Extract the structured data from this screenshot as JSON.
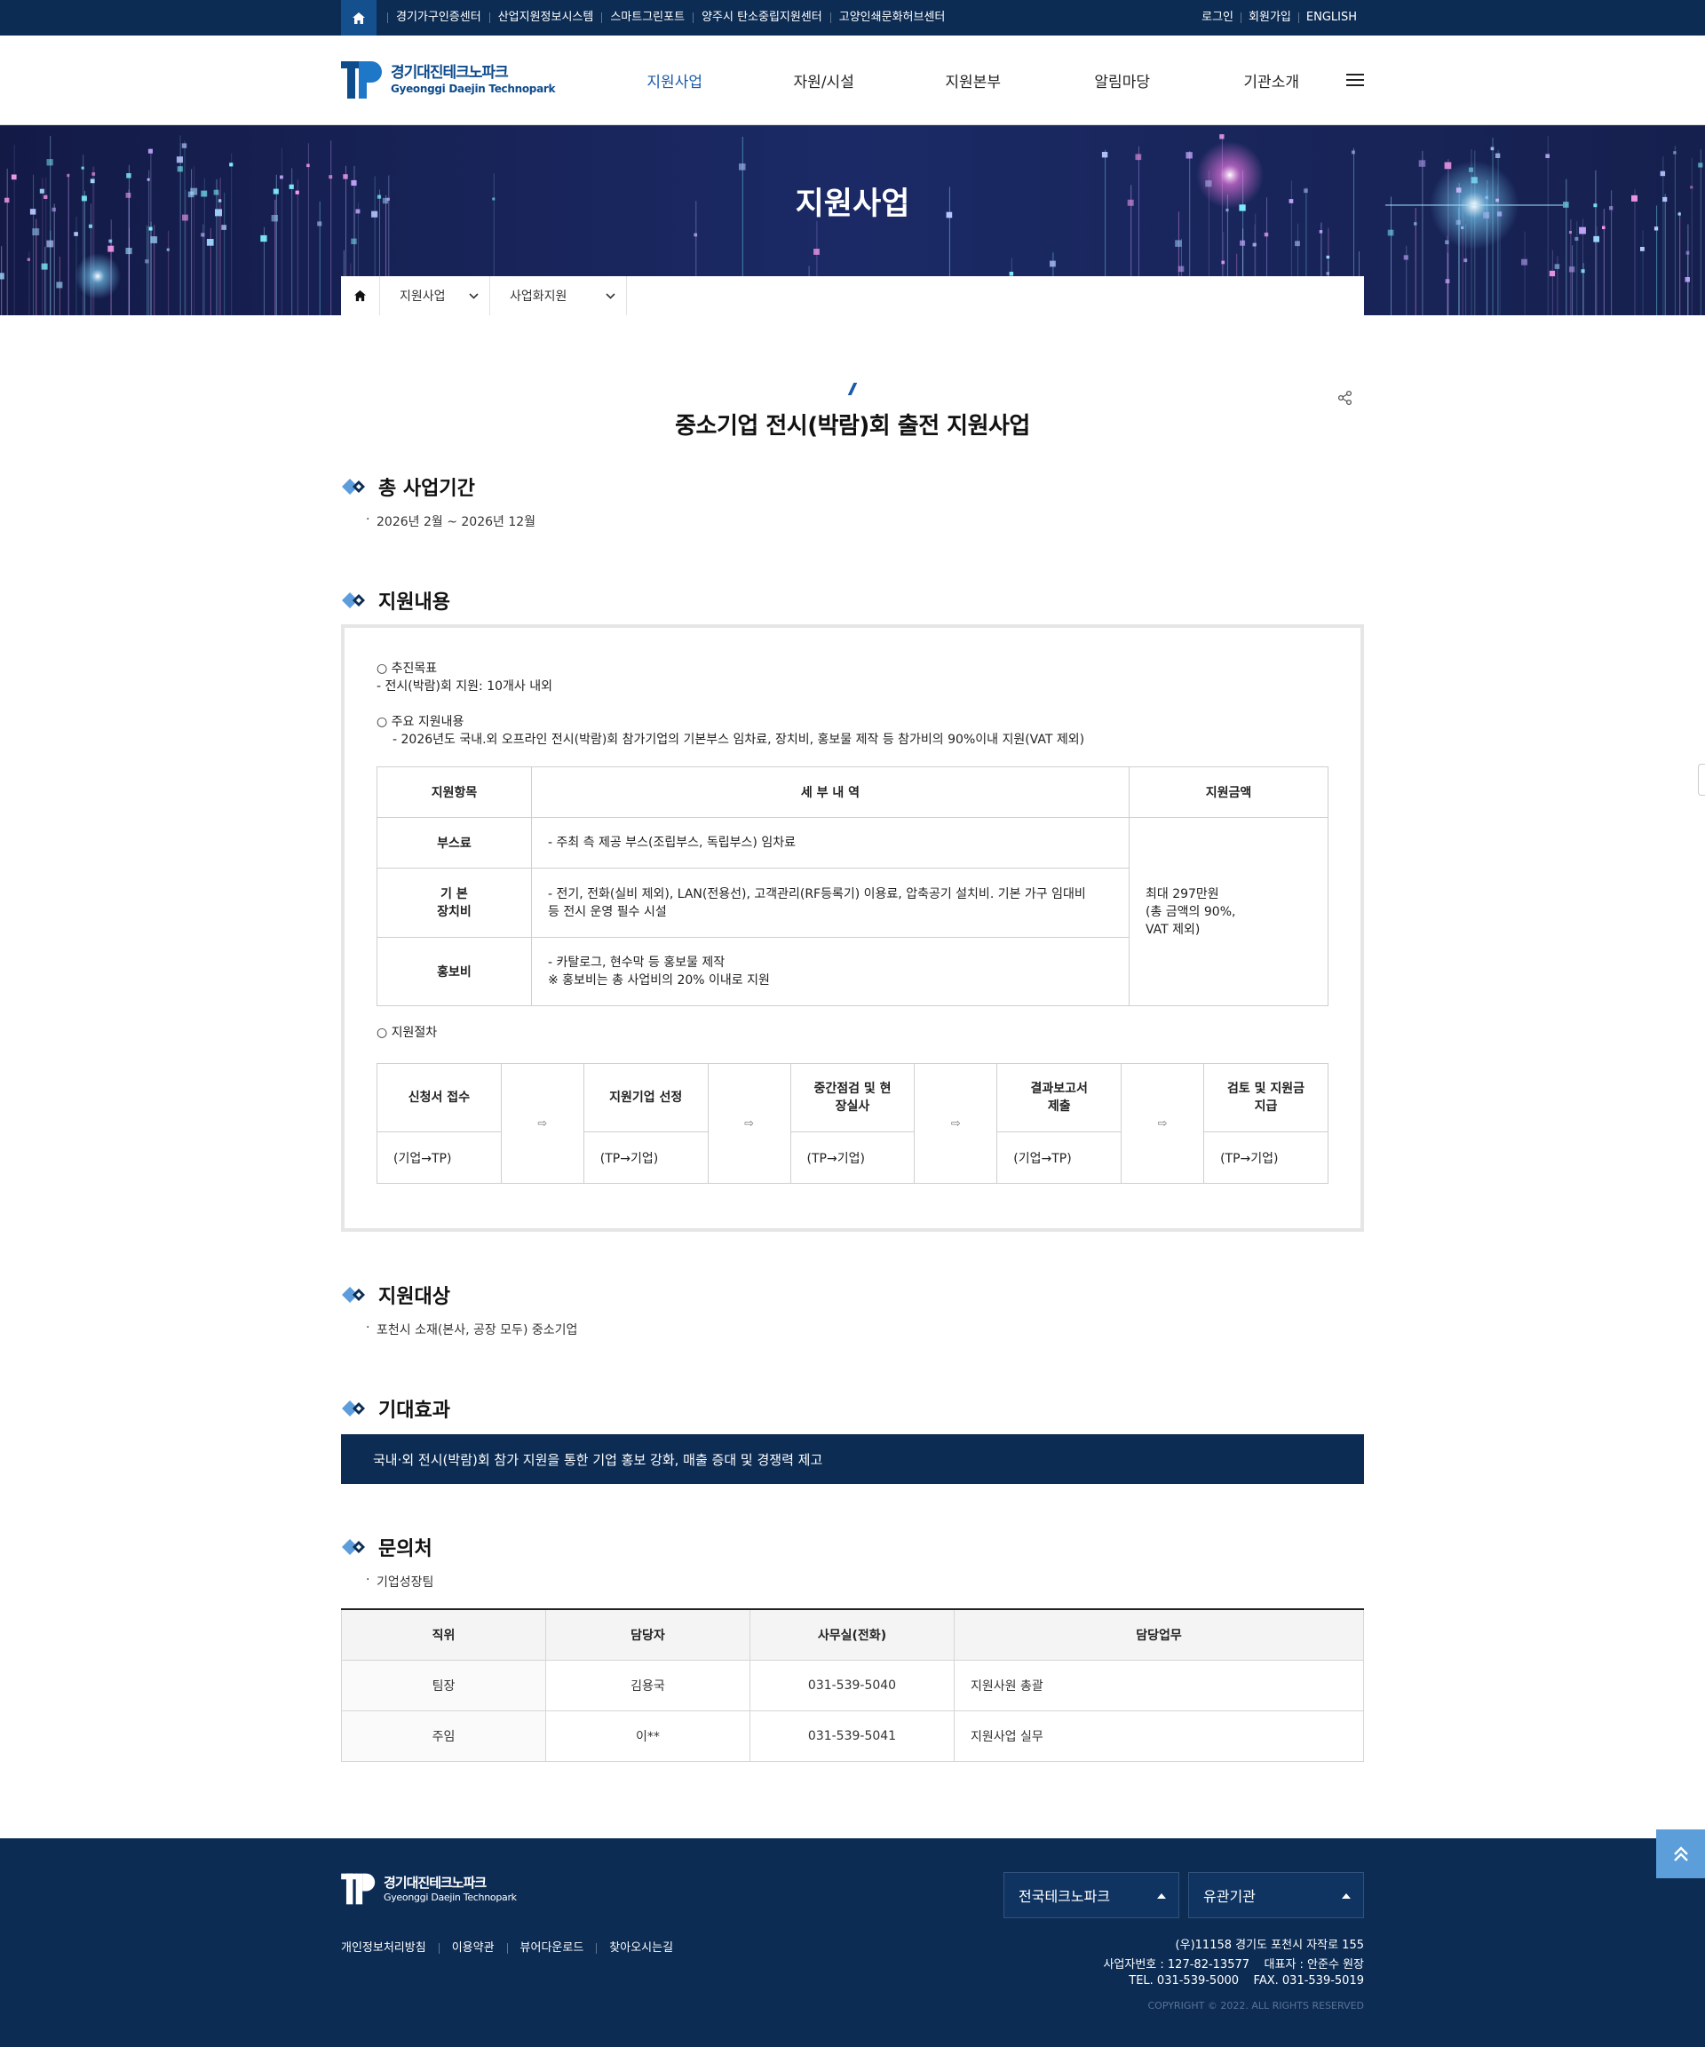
{
  "topbar": {
    "sites": [
      "경기가구인증센터",
      "산업지원정보시스템",
      "스마트그린포트",
      "양주시 탄소중립지원센터",
      "고양인쇄문화허브센터"
    ],
    "util": [
      "로그인",
      "회원가입",
      "ENGLISH"
    ]
  },
  "logo": {
    "kr": "경기대진테크노파크",
    "en": "Gyeonggi Daejin Technopark"
  },
  "gnb": [
    "지원사업",
    "자원/시설",
    "지원본부",
    "알림마당",
    "기관소개"
  ],
  "visual": {
    "title": "지원사업"
  },
  "location": {
    "depth1": "지원사업",
    "depth2": "사업화지원"
  },
  "page": {
    "title": "중소기업 전시(박람)회 출전 지원사업"
  },
  "period": {
    "heading": "총 사업기간",
    "text": "2026년 2월 ~ 2026년 12월"
  },
  "support": {
    "heading": "지원내용",
    "goal_title": "○ 추진목표",
    "goal_text": "- 전시(박람)회 지원: 10개사 내외",
    "main_title": "○ 주요 지원내용",
    "main_text": "- 2026년도 국내.외 오프라인 전시(박람)회 참가기업의 기본부스 임차료, 장치비, 홍보물 제작 등 참가비의 90%이내 지원(VAT 제외)",
    "table": {
      "headers": [
        "지원항목",
        "세 부 내 역",
        "지원금액"
      ],
      "rows": [
        {
          "item": "부스료",
          "detail": "- 주최 측 제공 부스(조립부스, 독립부스) 임차료",
          "detail2": ""
        },
        {
          "item": "기 본",
          "item2": "장치비",
          "detail": "- 전기, 전화(실비 제외), LAN(전용선), 고객관리(RF등록기) 이용료, 압축공기 설치비. 기본 가구 임대비",
          "detail2": "등 전시 운영 필수 시설"
        },
        {
          "item": "홍보비",
          "detail": "- 카탈로그, 현수막 등 홍보물 제작",
          "detail2": "※ 홍보비는 총 사업비의 20% 이내로 지원"
        }
      ],
      "amount": [
        "최대 297만원",
        "(총 금액의 90%,",
        "VAT 제외)"
      ]
    },
    "proc_title": "○ 지원절차",
    "steps": [
      {
        "name": "신청서 접수",
        "name2": "",
        "flow": "(기업→TP)"
      },
      {
        "name": "지원기업 선정",
        "name2": "",
        "flow": "(TP→기업)"
      },
      {
        "name": "중간점검 및 현",
        "name2": "장실사",
        "flow": "(TP→기업)"
      },
      {
        "name": "결과보고서",
        "name2": "제출",
        "flow": "(기업→TP)"
      },
      {
        "name": "검토 및 지원금",
        "name2": "지급",
        "flow": "(TP→기업)"
      }
    ],
    "arrow": "⇨"
  },
  "target": {
    "heading": "지원대상",
    "text": "포천시 소재(본사, 공장 모두) 중소기업"
  },
  "effect": {
    "heading": "기대효과",
    "text": "국내·외 전시(박람)회 참가 지원을 통한 기업 홍보 강화, 매출 증대 및 경쟁력 제고"
  },
  "contact": {
    "heading": "문의처",
    "team": "기업성장팀",
    "headers": [
      "직위",
      "담당자",
      "사무실(전화)",
      "담당업무"
    ],
    "rows": [
      [
        "팀장",
        "김용국",
        "031-539-5040",
        "지원사원 총괄"
      ],
      [
        "주임",
        "이**",
        "031-539-5041",
        "지원사업 실무"
      ]
    ]
  },
  "footer": {
    "logo_kr": "경기대진테크노파크",
    "logo_en": "Gyeonggi Daejin Technopark",
    "links": [
      "개인정보처리방침",
      "이용약관",
      "뷰어다운로드",
      "찾아오시는길"
    ],
    "select1": "전국테크노파크",
    "select2": "유관기관",
    "address": "(우)11158 경기도 포천시 자작로 155",
    "bizno": "사업자번호 : 127-82-13577    대표자 : 안준수 원장",
    "tel": "TEL. 031-539-5000    FAX. 031-539-5019",
    "copy": "COPYRIGHT © 2022. ALL RIGHTS RESERVED"
  },
  "colors": {
    "navy": "#0c2c54",
    "accent": "#1a5aa8",
    "topbtn": "#5b9ed9"
  }
}
